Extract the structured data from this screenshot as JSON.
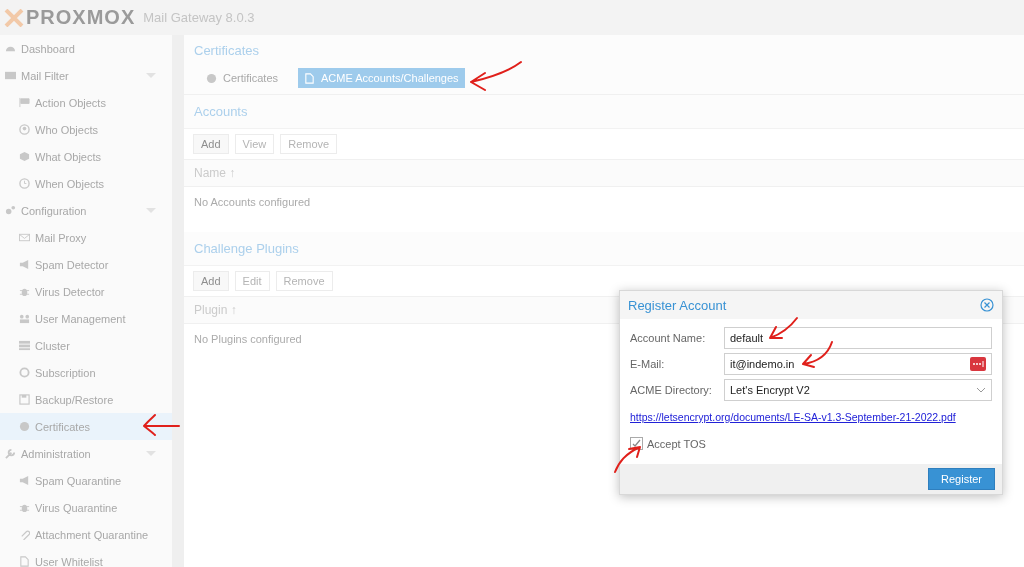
{
  "header": {
    "logo": "PROXMOX",
    "product": "Mail Gateway 8.0.3"
  },
  "sidebar": {
    "items": [
      {
        "label": "Dashboard",
        "selected": false
      },
      {
        "label": "Mail Filter",
        "selected": false,
        "expanded": true,
        "children": [
          {
            "label": "Action Objects",
            "selected": false
          },
          {
            "label": "Who Objects",
            "selected": false
          },
          {
            "label": "What Objects",
            "selected": false
          },
          {
            "label": "When Objects",
            "selected": false
          }
        ]
      },
      {
        "label": "Configuration",
        "selected": false,
        "expanded": true,
        "children": [
          {
            "label": "Mail Proxy",
            "selected": false
          },
          {
            "label": "Spam Detector",
            "selected": false
          },
          {
            "label": "Virus Detector",
            "selected": false
          },
          {
            "label": "User Management",
            "selected": false
          },
          {
            "label": "Cluster",
            "selected": false
          },
          {
            "label": "Subscription",
            "selected": false
          },
          {
            "label": "Backup/Restore",
            "selected": false
          },
          {
            "label": "Certificates",
            "selected": true
          }
        ]
      },
      {
        "label": "Administration",
        "selected": false,
        "expanded": true,
        "children": [
          {
            "label": "Spam Quarantine",
            "selected": false
          },
          {
            "label": "Virus Quarantine",
            "selected": false
          },
          {
            "label": "Attachment Quarantine",
            "selected": false
          },
          {
            "label": "User Whitelist",
            "selected": false
          }
        ]
      }
    ]
  },
  "content": {
    "title": "Certificates",
    "tabs": [
      {
        "label": "Certificates",
        "selected": false
      },
      {
        "label": "ACME Accounts/Challenges",
        "selected": true
      }
    ],
    "sections": [
      {
        "title": "Accounts",
        "buttons": [
          {
            "label": "Add",
            "disabled": false
          },
          {
            "label": "View",
            "disabled": true
          },
          {
            "label": "Remove",
            "disabled": true
          }
        ],
        "column": "Name ↑",
        "empty": "No Accounts configured"
      },
      {
        "title": "Challenge Plugins",
        "buttons": [
          {
            "label": "Add",
            "disabled": false
          },
          {
            "label": "Edit",
            "disabled": true
          },
          {
            "label": "Remove",
            "disabled": true
          }
        ],
        "column": "Plugin ↑",
        "empty": "No Plugins configured"
      }
    ]
  },
  "dialog": {
    "title": "Register Account",
    "fields": [
      {
        "kind": "text",
        "label": "Account Name:",
        "value": "default"
      },
      {
        "kind": "email",
        "label": "E-Mail:",
        "value": "it@indemo.in"
      },
      {
        "kind": "select",
        "label": "ACME Directory:",
        "value": "Let's Encrypt V2"
      }
    ],
    "link": "https://letsencrypt.org/documents/LE-SA-v1.3-September-21-2022.pdf",
    "checkbox": {
      "label": "Accept TOS",
      "checked": true
    },
    "button": "Register"
  }
}
